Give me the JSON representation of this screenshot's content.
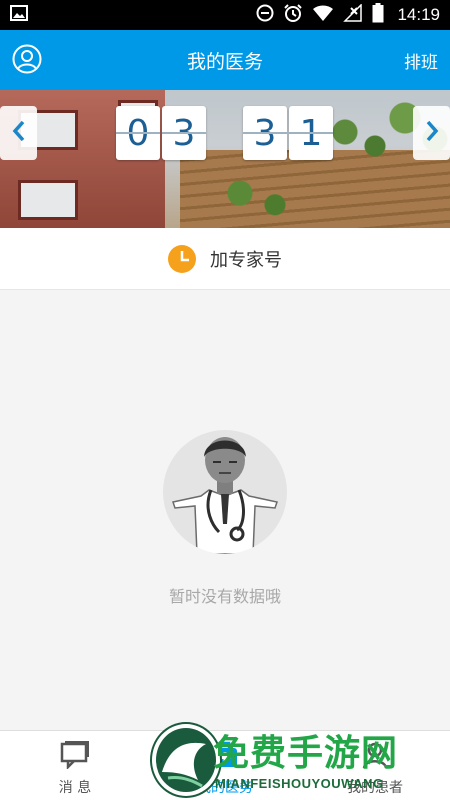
{
  "status_bar": {
    "time": "14:19",
    "icons": [
      "image-icon",
      "do-not-disturb-icon",
      "alarm-icon",
      "wifi-icon",
      "no-signal-icon",
      "battery-icon"
    ]
  },
  "app_bar": {
    "title": "我的医务",
    "right_action": "排班",
    "left_icon": "user-profile-icon"
  },
  "banner": {
    "date_digits": [
      "0",
      "3",
      "3",
      "1"
    ],
    "prev_icon": "chevron-left-icon",
    "next_icon": "chevron-right-icon"
  },
  "add_expert": {
    "label": "加专家号",
    "icon": "clock-icon"
  },
  "empty_state": {
    "message": "暂时没有数据哦",
    "illustration": "doctor-avatar"
  },
  "bottom_nav": {
    "items": [
      {
        "label": "消 息",
        "icon": "message-icon",
        "active": false
      },
      {
        "label": "我的医务",
        "icon": "medical-kit-icon",
        "active": true
      },
      {
        "label": "我的患者",
        "icon": "patient-icon",
        "active": false
      }
    ]
  },
  "watermark": {
    "title": "免费手游网",
    "subtitle": "MIANFEISHOUYOUWANG"
  },
  "colors": {
    "primary": "#0099e8",
    "clock_orange": "#f5a11c",
    "empty_text": "#a8a8a8",
    "digit_blue": "#1c5f94"
  }
}
